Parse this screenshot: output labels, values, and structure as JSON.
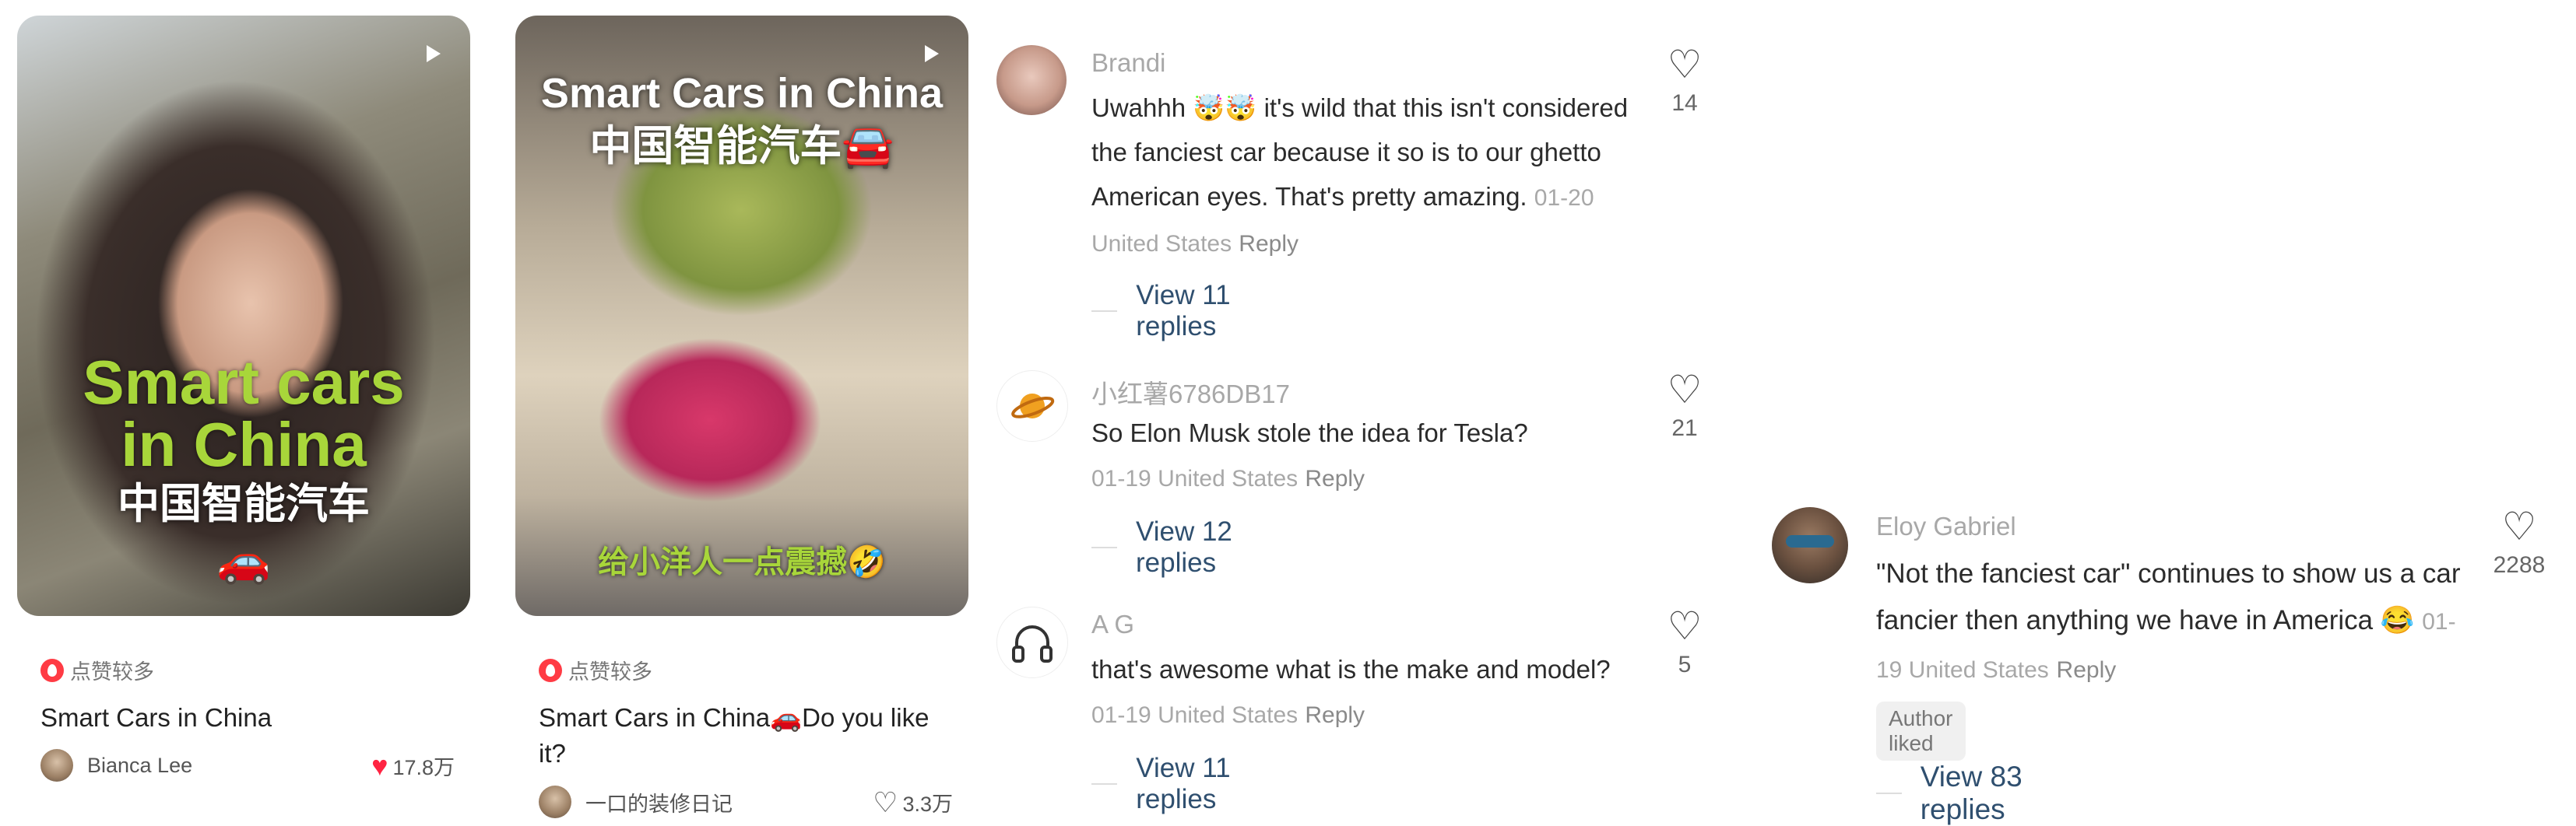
{
  "cards": [
    {
      "overlay": [
        "Smart cars",
        "in China",
        "中国智能汽车",
        "🚗"
      ],
      "badge": "点赞较多",
      "title": "Smart Cars in China",
      "author": "Bianca Lee",
      "likes": "17.8万"
    },
    {
      "overlay": [
        "Smart Cars in China",
        "中国智能汽车🚘",
        "给小洋人一点震撼🤣"
      ],
      "badge": "点赞较多",
      "title": "Smart Cars in China🚗Do you like it?",
      "author": "一口的装修日记",
      "likes": "3.3万"
    }
  ],
  "comments": [
    {
      "user": "Brandi",
      "text": "Uwahhh 🤯🤯 it's wild that this isn't considered the fanciest car because it so is to our ghetto American eyes. That's pretty amazing.",
      "meta": "01-20 United States",
      "reply": "Reply",
      "likes": "14",
      "view_replies": "View 11 replies"
    },
    {
      "user": "小红薯6786DB17",
      "text": "So Elon Musk stole the idea for Tesla?",
      "meta": "01-19 United States",
      "reply": "Reply",
      "likes": "21",
      "view_replies": "View 12 replies"
    },
    {
      "user": "A G",
      "text": "that's awesome what is the make and model?",
      "meta": "01-19 United States",
      "reply": "Reply",
      "likes": "5",
      "view_replies": "View 11 replies"
    },
    {
      "user": "Eloy Gabriel",
      "text": "\"Not the fanciest car\" continues to show us a car fancier then anything we have in America 😂",
      "meta": "01-19 United States",
      "reply": "Reply",
      "likes": "2288",
      "tag": "Author liked",
      "view_replies": "View 83 replies"
    }
  ],
  "colors": {
    "accent_red": "#ff2442",
    "overlay_green": "#a8d63a",
    "link_blue": "#2f4f6f"
  }
}
